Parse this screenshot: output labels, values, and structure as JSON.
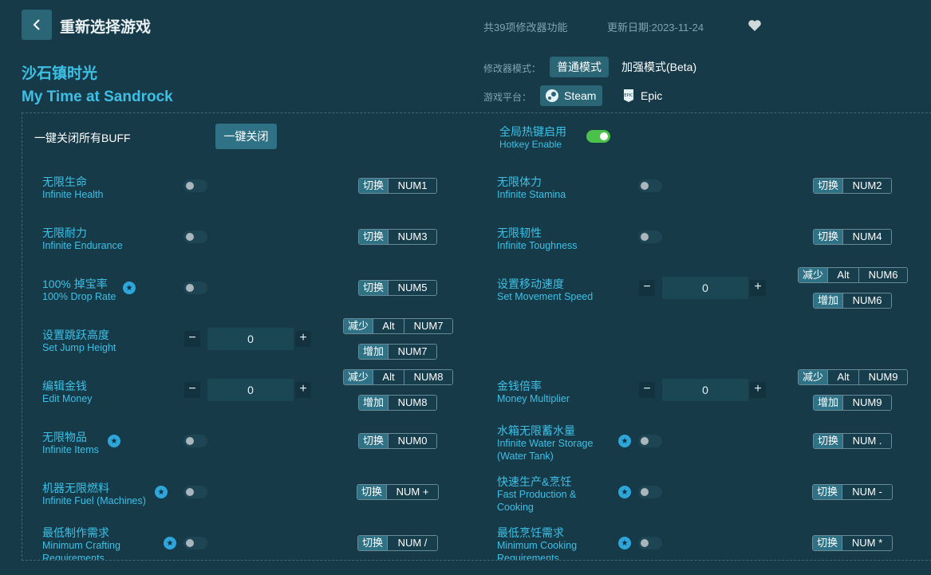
{
  "header": {
    "title": "重新选择游戏",
    "feature_count": "共39项修改器功能",
    "update_date": "更新日期:2023-11-24"
  },
  "game": {
    "name_cn": "沙石镇时光",
    "name_en": "My Time at Sandrock"
  },
  "mode": {
    "label": "修改器模式：",
    "normal": "普通模式",
    "enhanced": "加强模式(Beta)"
  },
  "platform": {
    "label": "游戏平台：",
    "steam": "Steam",
    "epic": "Epic"
  },
  "controls": {
    "close_all_label": "一键关闭所有BUFF",
    "close_all_button": "一键关闭",
    "hotkey_cn": "全局热键启用",
    "hotkey_en": "Hotkey Enable",
    "hotkey_enabled": true
  },
  "labels": {
    "toggle": "切换",
    "decrease": "减少",
    "increase": "增加",
    "alt": "Alt",
    "minus": "−",
    "plus": "+"
  },
  "features": [
    {
      "cn": "无限生命",
      "en": "Infinite Health",
      "key": "NUM1"
    },
    {
      "cn": "无限体力",
      "en": "Infinite Stamina",
      "key": "NUM2"
    },
    {
      "cn": "无限耐力",
      "en": "Infinite Endurance",
      "key": "NUM3"
    },
    {
      "cn": "无限韧性",
      "en": "Infinite Toughness",
      "key": "NUM4"
    },
    {
      "cn": "100% 掉宝率",
      "en": "100% Drop Rate",
      "key": "NUM5",
      "star": true
    },
    {
      "cn": "设置移动速度",
      "en": "Set Movement Speed",
      "value": "0",
      "dec_key": "NUM6",
      "inc_key": "NUM6"
    },
    {
      "cn": "设置跳跃高度",
      "en": "Set Jump Height",
      "value": "0",
      "dec_key": "NUM7",
      "inc_key": "NUM7"
    },
    {
      "cn": "编辑金钱",
      "en": "Edit Money",
      "value": "0",
      "dec_key": "NUM8",
      "inc_key": "NUM8"
    },
    {
      "cn": "金钱倍率",
      "en": "Money Multiplier",
      "value": "0",
      "dec_key": "NUM9",
      "inc_key": "NUM9"
    },
    {
      "cn": "无限物品",
      "en": "Infinite Items",
      "key": "NUM0",
      "star": true
    },
    {
      "cn": "水箱无限蓄水量",
      "en": "Infinite Water Storage",
      "en2": "(Water Tank)",
      "key": "NUM .",
      "star": true
    },
    {
      "cn": "机器无限燃料",
      "en": "Infinite Fuel (Machines)",
      "key": "NUM +",
      "star": true
    },
    {
      "cn": "快速生产&烹饪",
      "en": "Fast Production &",
      "en2": "Cooking",
      "key": "NUM -",
      "star": true
    },
    {
      "cn": "最低制作需求",
      "en": "Minimum Crafting",
      "en2": "Requirements",
      "key": "NUM /",
      "star": true
    },
    {
      "cn": "最低烹饪需求",
      "en": "Minimum Cooking",
      "en2": "Requirements",
      "key": "NUM *",
      "star": true
    }
  ]
}
